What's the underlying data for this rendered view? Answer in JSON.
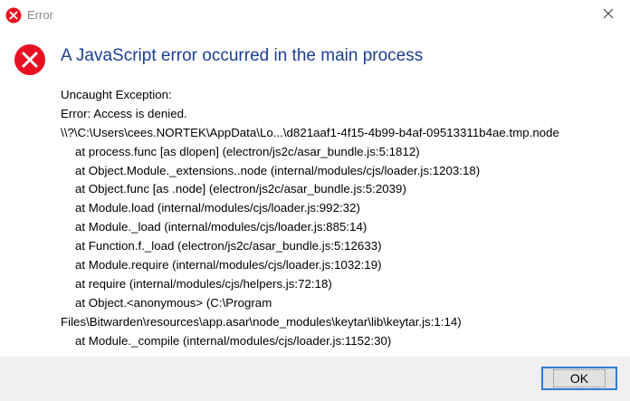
{
  "window": {
    "title": "Error",
    "icon": "error-icon",
    "close_icon": "close-icon"
  },
  "dialog": {
    "heading": "A JavaScript error occurred in the main process",
    "icon": "error-circle-icon",
    "lines": [
      "Uncaught Exception:",
      "Error: Access is denied.",
      "\\\\?\\C:\\Users\\cees.NORTEK\\AppData\\Lo...\\d821aaf1-4f15-4b99-b4af-09513311b4ae.tmp.node",
      "at process.func [as dlopen] (electron/js2c/asar_bundle.js:5:1812)",
      "at Object.Module._extensions..node (internal/modules/cjs/loader.js:1203:18)",
      "at Object.func [as .node] (electron/js2c/asar_bundle.js:5:2039)",
      "at Module.load (internal/modules/cjs/loader.js:992:32)",
      "at Module._load (internal/modules/cjs/loader.js:885:14)",
      "at Function.f._load (electron/js2c/asar_bundle.js:5:12633)",
      "at Module.require (internal/modules/cjs/loader.js:1032:19)",
      "at require (internal/modules/cjs/helpers.js:72:18)",
      "at Object.<anonymous> (C:\\Program",
      "Files\\Bitwarden\\resources\\app.asar\\node_modules\\keytar\\lib\\keytar.js:1:14)",
      "at Module._compile (internal/modules/cjs/loader.js:1152:30)"
    ]
  },
  "buttons": {
    "ok_label": "OK"
  },
  "colors": {
    "heading": "#1c3f94",
    "error_red": "#e81123",
    "footer_bg": "#f0f0f0",
    "focus_border": "#2f7cd6"
  }
}
